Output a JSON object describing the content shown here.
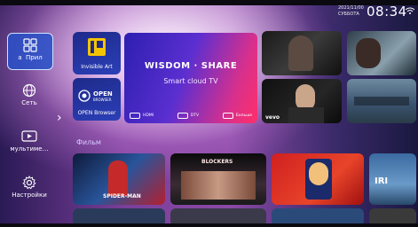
{
  "status": {
    "time": "08:34",
    "date": "2021/11/00",
    "weekday": "СУББОТА"
  },
  "sidebar": {
    "items": [
      {
        "label": "Прил",
        "icon": "apps-grid-icon",
        "active": true,
        "prefix": "a"
      },
      {
        "label": "Сеть",
        "icon": "globe-icon"
      },
      {
        "label": "мультиме…",
        "icon": "media-play-icon"
      },
      {
        "label": "Настройки",
        "icon": "settings-gear-icon"
      }
    ]
  },
  "apps": [
    {
      "name": "Invisible Art",
      "logo": "iA"
    },
    {
      "name": "OPEN Browser",
      "logo": "OPEN",
      "sub": "BROWSER"
    }
  ],
  "hero": {
    "title": "WISDOM · SHARE",
    "subtitle": "Smart cloud TV",
    "inputs": [
      "HDMI",
      "DTV",
      "Больше"
    ]
  },
  "recommend": [
    {
      "name": "recommend-tile-1",
      "caption": ""
    },
    {
      "name": "recommend-tile-2",
      "caption": ""
    },
    {
      "name": "recommend-tile-3",
      "caption": "vevo"
    },
    {
      "name": "recommend-tile-4",
      "caption": ""
    }
  ],
  "section_title": "Фильм",
  "movies": [
    {
      "caption": "SPIDER-MAN"
    },
    {
      "caption": "BLOCKERS"
    },
    {
      "caption": ""
    },
    {
      "caption": "IRI"
    }
  ],
  "colors": {
    "accent": "#2f55d0",
    "hero_start": "#2d1fb0",
    "hero_end": "#ff2f6a"
  }
}
